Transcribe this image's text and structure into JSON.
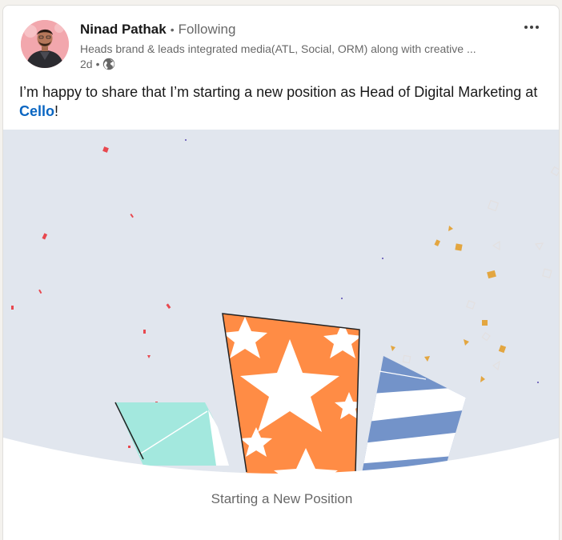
{
  "post": {
    "author_name": "Ninad Pathak",
    "relation_separator": "•",
    "relation": "Following",
    "headline": "Heads brand & leads integrated media(ATL, Social, ORM) along with creative ...",
    "age": "2d",
    "age_separator": "•",
    "visibility_icon": "globe-icon",
    "more_icon": "more-options-icon",
    "text_prefix": "I’m happy to share that I’m starting a new position as Head of Digital Marketing at ",
    "company": "Cello",
    "text_suffix": "!",
    "image_caption": "Starting a New Position"
  },
  "colors": {
    "link": "#0a66c2",
    "orange_card": "#ff8c45",
    "blue_card": "#7393c9",
    "teal_card": "#a3e8de",
    "image_background": "#e1e6ee"
  }
}
